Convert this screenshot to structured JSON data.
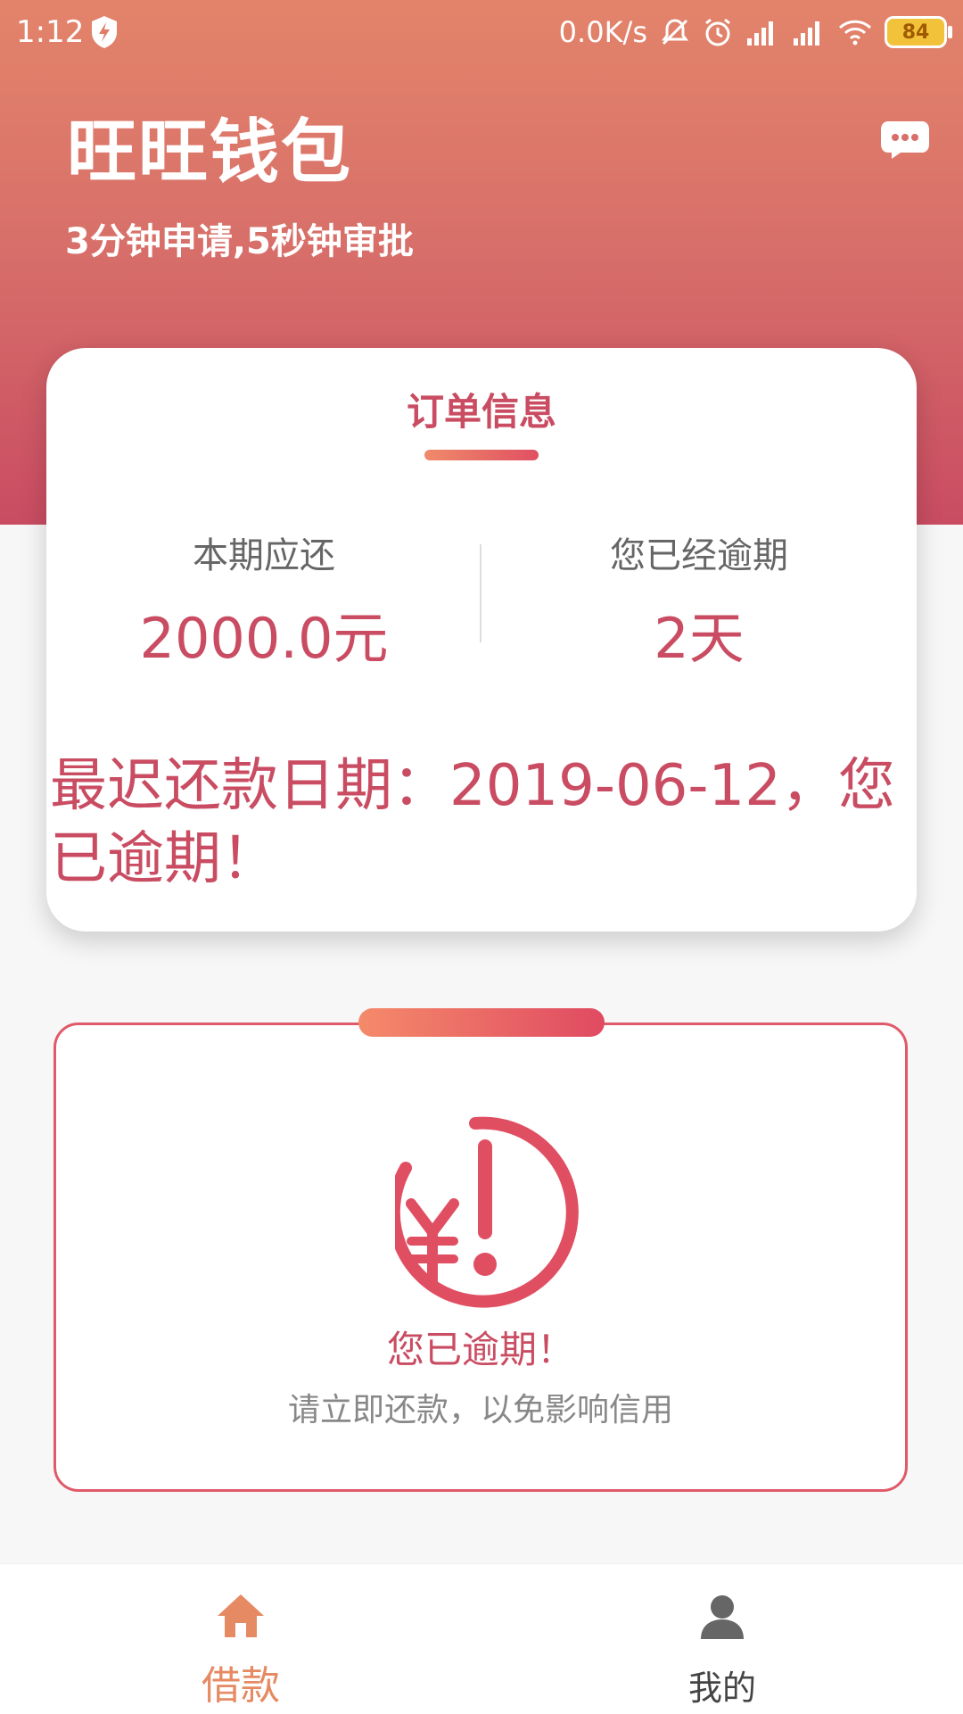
{
  "status_bar": {
    "time": "1:12",
    "speed": "0.0K/s",
    "battery": "84"
  },
  "header": {
    "title": "旺旺钱包",
    "subtitle": "3分钟申请,5秒钟审批"
  },
  "order_card": {
    "title": "订单信息",
    "left_label": "本期应还",
    "left_value": "2000.0元",
    "right_label": "您已经逾期",
    "right_value": "2天",
    "due_text": "最迟还款日期：2019-06-12，您已逾期！"
  },
  "overdue_card": {
    "title": "您已逾期！",
    "subtitle": "请立即还款，以免影响信用"
  },
  "bottom_nav": {
    "items": [
      {
        "label": "借款",
        "icon": "home-icon"
      },
      {
        "label": "我的",
        "icon": "person-icon"
      }
    ]
  },
  "colors": {
    "accent": "#c94c62",
    "header_top": "#e3846a",
    "header_bottom": "#c94c62",
    "nav_active": "#e58a62"
  }
}
